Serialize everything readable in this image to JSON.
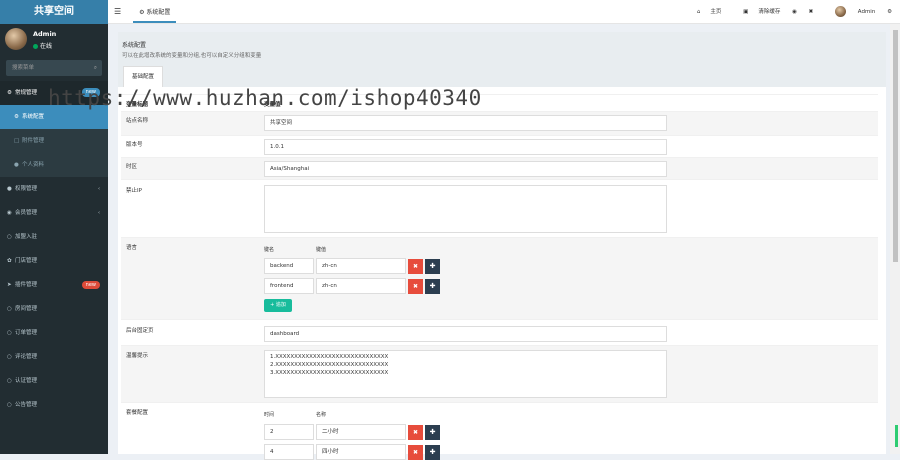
{
  "app": {
    "logo": "共享空间"
  },
  "user": {
    "name": "Admin",
    "status": "在线"
  },
  "search": {
    "placeholder": "搜索菜单",
    "icon": "search-icon"
  },
  "sidebar": {
    "items": [
      {
        "label": "常规管理",
        "badge": "new",
        "icon": "cogs-icon"
      },
      {
        "label": "系统配置",
        "icon": "gear-icon"
      },
      {
        "label": "附件管理",
        "icon": "file-icon"
      },
      {
        "label": "个人资料",
        "icon": "user-icon"
      },
      {
        "label": "权限管理",
        "icon": "users-icon"
      },
      {
        "label": "会员管理",
        "icon": "user-circle-icon"
      },
      {
        "label": "加盟入驻",
        "icon": "circle-icon"
      },
      {
        "label": "门店管理",
        "icon": "leaf-icon"
      },
      {
        "label": "插件管理",
        "badge": "new",
        "icon": "rocket-icon"
      },
      {
        "label": "房间管理",
        "icon": "circle-icon"
      },
      {
        "label": "订单管理",
        "icon": "circle-icon"
      },
      {
        "label": "评论管理",
        "icon": "circle-icon"
      },
      {
        "label": "认证管理",
        "icon": "circle-icon"
      },
      {
        "label": "公告管理",
        "icon": "circle-icon"
      }
    ]
  },
  "topbar": {
    "tab": "系统配置",
    "home": "主页",
    "clear_cache": "清除缓存",
    "admin": "Admin"
  },
  "panel": {
    "title": "系统配置",
    "desc": "可以在此增改系统的变量和分组,也可以自定义分组和变量",
    "tab": "基础配置"
  },
  "table": {
    "col1": "变量标题",
    "col2": "变量值"
  },
  "fields": {
    "site_name": {
      "label": "站点名称",
      "value": "共享空间"
    },
    "version": {
      "label": "版本号",
      "value": "1.0.1"
    },
    "timezone": {
      "label": "时区",
      "value": "Asia/Shanghai"
    },
    "forbidden_ip": {
      "label": "禁止IP",
      "value": ""
    },
    "language": {
      "label": "语言",
      "key_header": "键名",
      "val_header": "键值",
      "rows": [
        [
          "backend",
          "zh-cn"
        ],
        [
          "frontend",
          "zh-cn"
        ]
      ],
      "add_label": "追加"
    },
    "backend_index": {
      "label": "后台固定页",
      "value": "dashboard"
    },
    "tips": {
      "label": "温馨提示",
      "lines": [
        "1.XXXXXXXXXXXXXXXXXXXXXXXXXXXXXX",
        "2.XXXXXXXXXXXXXXXXXXXXXXXXXXXXXX",
        "3.XXXXXXXXXXXXXXXXXXXXXXXXXXXXXX"
      ]
    },
    "package": {
      "label": "套餐配置",
      "key_header": "时间",
      "val_header": "名称",
      "rows": [
        [
          "2",
          "二小时"
        ],
        [
          "4",
          "四小时"
        ]
      ]
    }
  },
  "watermark": "https://www.huzhan.com/ishop40340"
}
